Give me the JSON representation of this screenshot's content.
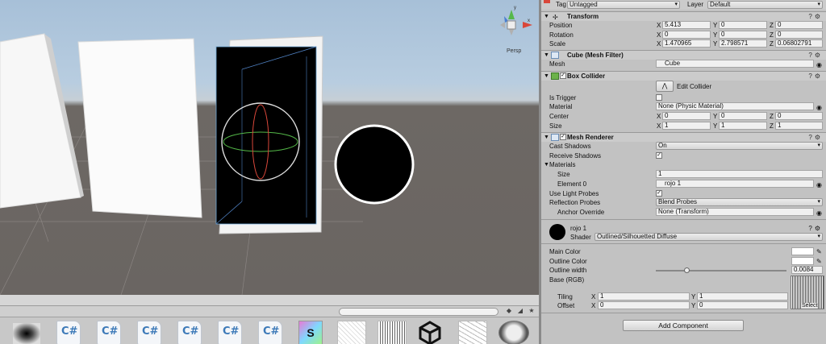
{
  "scene": {
    "persp_label": "Persp"
  },
  "project": {
    "assets": [
      {
        "kind": "gradient"
      },
      {
        "kind": "cs",
        "label": "C#"
      },
      {
        "kind": "cs",
        "label": "C#"
      },
      {
        "kind": "cs",
        "label": "C#"
      },
      {
        "kind": "cs",
        "label": "C#"
      },
      {
        "kind": "cs",
        "label": "C#"
      },
      {
        "kind": "cs",
        "label": "C#"
      },
      {
        "kind": "shader",
        "label": "S"
      },
      {
        "kind": "noise"
      },
      {
        "kind": "noise"
      },
      {
        "kind": "unity"
      },
      {
        "kind": "noise"
      },
      {
        "kind": "sphere"
      }
    ]
  },
  "inspector": {
    "tag_label": "Tag",
    "tag_value": "Untagged",
    "layer_label": "Layer",
    "layer_value": "Default",
    "transform": {
      "title": "Transform",
      "position_label": "Position",
      "position": {
        "x": "5.413",
        "y": "0",
        "z": "0"
      },
      "rotation_label": "Rotation",
      "rotation": {
        "x": "0",
        "y": "0",
        "z": "0"
      },
      "scale_label": "Scale",
      "scale": {
        "x": "1.470965",
        "y": "2.798571",
        "z": "0.06802791"
      }
    },
    "mesh_filter": {
      "title": "Cube (Mesh Filter)",
      "mesh_label": "Mesh",
      "mesh_value": "Cube"
    },
    "box_collider": {
      "title": "Box Collider",
      "edit_label": "Edit Collider",
      "is_trigger_label": "Is Trigger",
      "material_label": "Material",
      "material_value": "None (Physic Material)",
      "center_label": "Center",
      "center": {
        "x": "0",
        "y": "0",
        "z": "0"
      },
      "size_label": "Size",
      "size": {
        "x": "1",
        "y": "1",
        "z": "1"
      }
    },
    "mesh_renderer": {
      "title": "Mesh Renderer",
      "cast_shadows_label": "Cast Shadows",
      "cast_shadows_value": "On",
      "receive_shadows_label": "Receive Shadows",
      "materials_label": "Materials",
      "size_label": "Size",
      "size_value": "1",
      "element0_label": "Element 0",
      "element0_value": "rojo 1",
      "light_probes_label": "Use Light Probes",
      "reflection_label": "Reflection Probes",
      "reflection_value": "Blend Probes",
      "anchor_label": "Anchor Override",
      "anchor_value": "None (Transform)"
    },
    "material": {
      "name": "rojo 1",
      "shader_label": "Shader",
      "shader_value": "Outlined/Silhouetted Diffuse",
      "main_color_label": "Main Color",
      "outline_color_label": "Outline Color",
      "outline_width_label": "Outline width",
      "outline_width_value": "0.0084",
      "outline_width_fraction": 0.24,
      "base_label": "Base (RGB)",
      "tiling_label": "Tiling",
      "tiling": {
        "x": "1",
        "y": "1"
      },
      "offset_label": "Offset",
      "offset": {
        "x": "0",
        "y": "0"
      },
      "select_label": "Select"
    },
    "add_component_label": "Add Component",
    "axis_x": "X",
    "axis_y": "Y",
    "axis_z": "Z"
  }
}
